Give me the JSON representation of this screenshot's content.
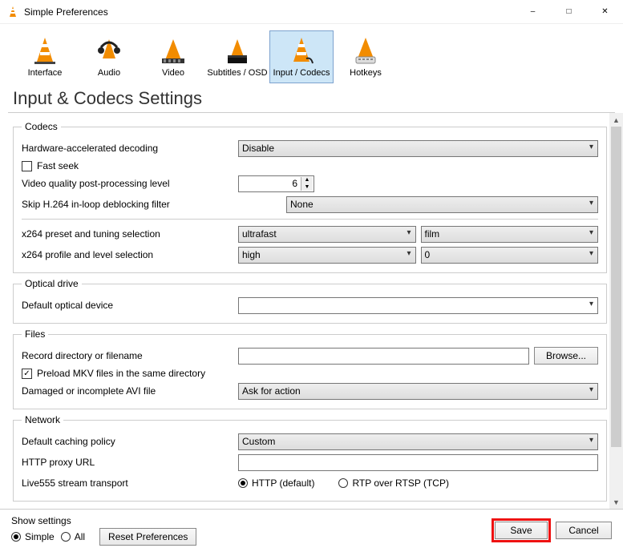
{
  "window": {
    "title": "Simple Preferences"
  },
  "tabs": {
    "interface": "Interface",
    "audio": "Audio",
    "video": "Video",
    "subs": "Subtitles / OSD",
    "input": "Input / Codecs",
    "hotkeys": "Hotkeys"
  },
  "headline": "Input & Codecs Settings",
  "codecs": {
    "legend": "Codecs",
    "hw_label": "Hardware-accelerated decoding",
    "hw_value": "Disable",
    "fast_seek": "Fast seek",
    "vq_label": "Video quality post-processing level",
    "vq_value": "6",
    "skip_label": "Skip H.264 in-loop deblocking filter",
    "skip_value": "None",
    "x264preset_label": "x264 preset and tuning selection",
    "x264preset_a": "ultrafast",
    "x264preset_b": "film",
    "x264profile_label": "x264 profile and level selection",
    "x264profile_a": "high",
    "x264profile_b": "0"
  },
  "optical": {
    "legend": "Optical drive",
    "default_label": "Default optical device",
    "default_value": ""
  },
  "files": {
    "legend": "Files",
    "record_label": "Record directory or filename",
    "record_value": "",
    "browse": "Browse...",
    "preload": "Preload MKV files in the same directory",
    "damaged_label": "Damaged or incomplete AVI file",
    "damaged_value": "Ask for action"
  },
  "network": {
    "legend": "Network",
    "caching_label": "Default caching policy",
    "caching_value": "Custom",
    "proxy_label": "HTTP proxy URL",
    "proxy_value": "",
    "live_label": "Live555 stream transport",
    "live_http": "HTTP (default)",
    "live_rtp": "RTP over RTSP (TCP)"
  },
  "bottom": {
    "show_label": "Show settings",
    "simple": "Simple",
    "all": "All",
    "reset": "Reset Preferences",
    "save": "Save",
    "cancel": "Cancel"
  }
}
